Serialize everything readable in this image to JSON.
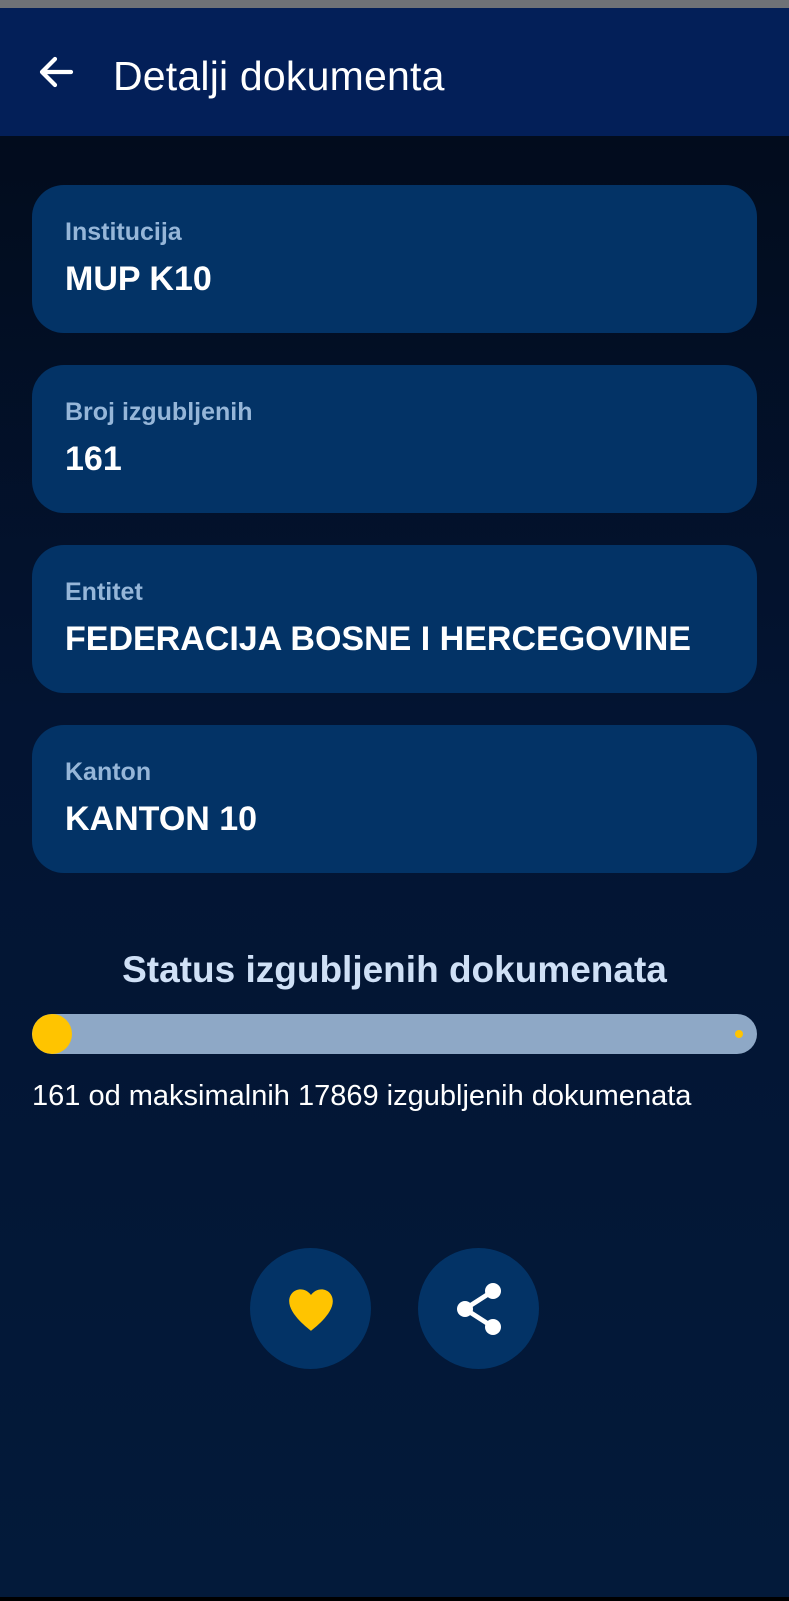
{
  "header": {
    "back_icon": "arrow-left-icon",
    "title": "Detalji dokumenta"
  },
  "details": [
    {
      "label": "Institucija",
      "value": "MUP K10"
    },
    {
      "label": "Broj izgubljenih",
      "value": "161"
    },
    {
      "label": "Entitet",
      "value": "FEDERACIJA BOSNE I HERCEGOVINE"
    },
    {
      "label": "Kanton",
      "value": "KANTON 10"
    }
  ],
  "status": {
    "title": "Status izgubljenih dokumenata",
    "current": 161,
    "maximum": 17869,
    "description": "161 od maksimalnih 17869 izgubljenih dokumenata"
  },
  "actions": {
    "favorite_icon": "heart-icon",
    "share_icon": "share-icon"
  },
  "colors": {
    "app_bar": "#031f58",
    "card": "#033366",
    "label": "#96b6d8",
    "accent": "#ffc400",
    "track": "#8ea8c6"
  }
}
